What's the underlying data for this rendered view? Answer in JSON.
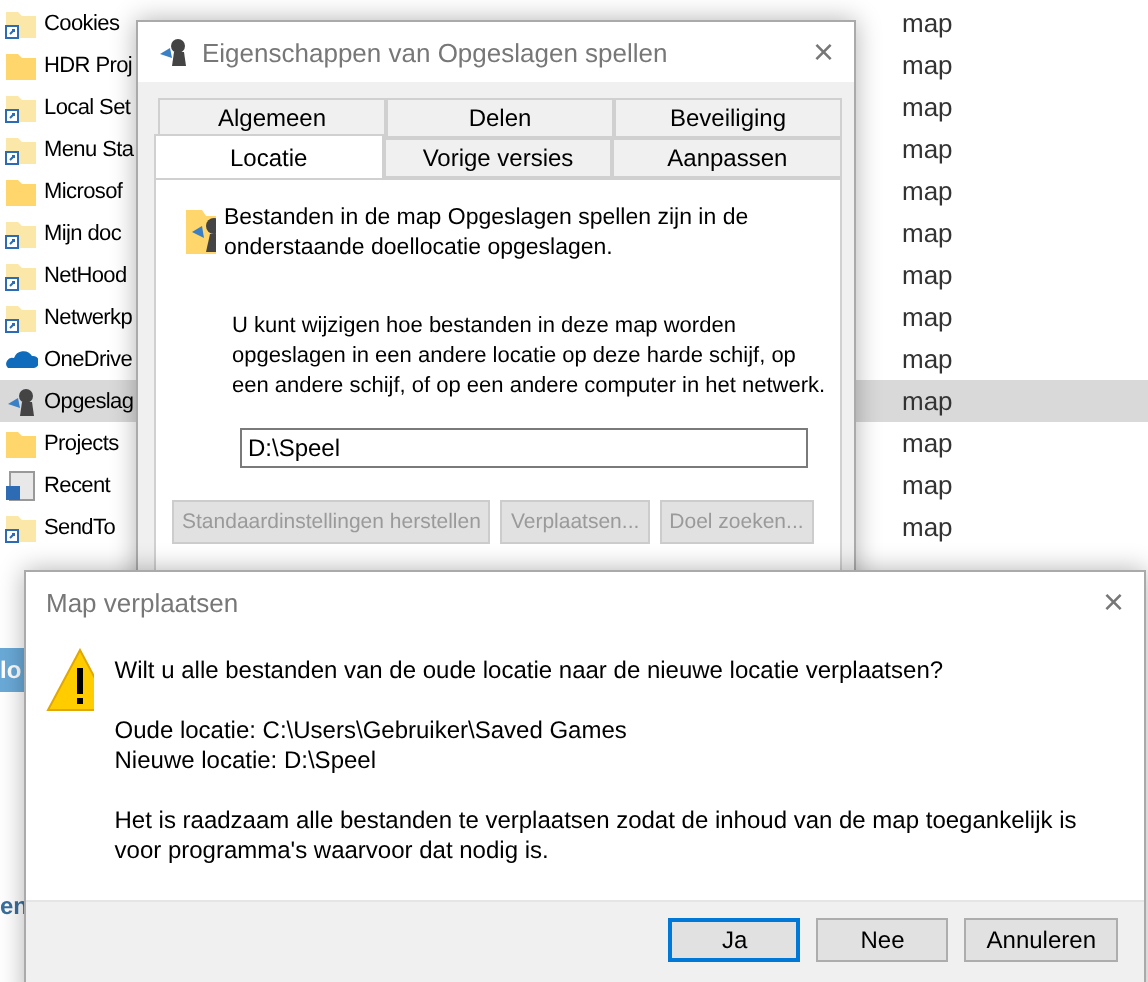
{
  "explorer": {
    "rows": [
      {
        "name": "Cookies",
        "type": "map",
        "kind": "shortcut",
        "selected": false
      },
      {
        "name": "HDR Proj",
        "type": "map",
        "kind": "folder",
        "selected": false
      },
      {
        "name": "Local Set",
        "type": "map",
        "kind": "shortcut",
        "selected": false
      },
      {
        "name": "Menu Sta",
        "type": "map",
        "kind": "shortcut",
        "selected": false
      },
      {
        "name": "Microsof",
        "type": "map",
        "kind": "folder",
        "selected": false
      },
      {
        "name": "Mijn doc",
        "type": "map",
        "kind": "shortcut",
        "selected": false
      },
      {
        "name": "NetHood",
        "type": "map",
        "kind": "shortcut",
        "selected": false
      },
      {
        "name": "Netwerkp",
        "type": "map",
        "kind": "shortcut",
        "selected": false
      },
      {
        "name": "OneDrive",
        "type": "map",
        "kind": "cloud",
        "selected": false
      },
      {
        "name": "Opgeslag",
        "type": "map",
        "kind": "games",
        "selected": true
      },
      {
        "name": "Projects",
        "type": "map",
        "kind": "folder",
        "selected": false
      },
      {
        "name": "Recent",
        "type": "map",
        "kind": "recent",
        "selected": false
      },
      {
        "name": "SendTo",
        "type": "map",
        "kind": "shortcut",
        "selected": false
      }
    ],
    "side_button": "lo",
    "side_link": "en"
  },
  "properties": {
    "title": "Eigenschappen van Opgeslagen spellen",
    "close": "×",
    "tab_rows": [
      [
        {
          "label": "Algemeen",
          "selected": false
        },
        {
          "label": "Delen",
          "selected": false
        },
        {
          "label": "Beveiliging",
          "selected": false
        }
      ],
      [
        {
          "label": "Locatie",
          "selected": true
        },
        {
          "label": "Vorige versies",
          "selected": false
        },
        {
          "label": "Aanpassen",
          "selected": false
        }
      ]
    ],
    "intro": "Bestanden in de map Opgeslagen spellen zijn in de onderstaande doellocatie opgeslagen.",
    "explanation": "U kunt wijzigen hoe bestanden in deze map worden opgeslagen in een andere locatie op deze harde schijf, op een andere schijf, of op een andere computer in het netwerk.",
    "path": "D:\\Speel",
    "buttons": [
      {
        "label": "Standaardinstellingen herstellen",
        "disabled": true
      },
      {
        "label": "Verplaatsen...",
        "disabled": true
      },
      {
        "label": "Doel zoeken...",
        "disabled": true
      }
    ]
  },
  "move_dialog": {
    "title": "Map verplaatsen",
    "close": "×",
    "question": "Wilt u alle bestanden van de oude locatie naar de nieuwe locatie verplaatsen?",
    "old_location": "Oude locatie: C:\\Users\\Gebruiker\\Saved Games",
    "new_location": "Nieuwe locatie: D:\\Speel",
    "advice": "Het is raadzaam alle bestanden te verplaatsen zodat de inhoud van de map toegankelijk is voor programma's waarvoor dat nodig is.",
    "buttons": [
      {
        "label": "Ja",
        "default": true
      },
      {
        "label": "Nee",
        "default": false
      },
      {
        "label": "Annuleren",
        "default": false
      }
    ]
  }
}
